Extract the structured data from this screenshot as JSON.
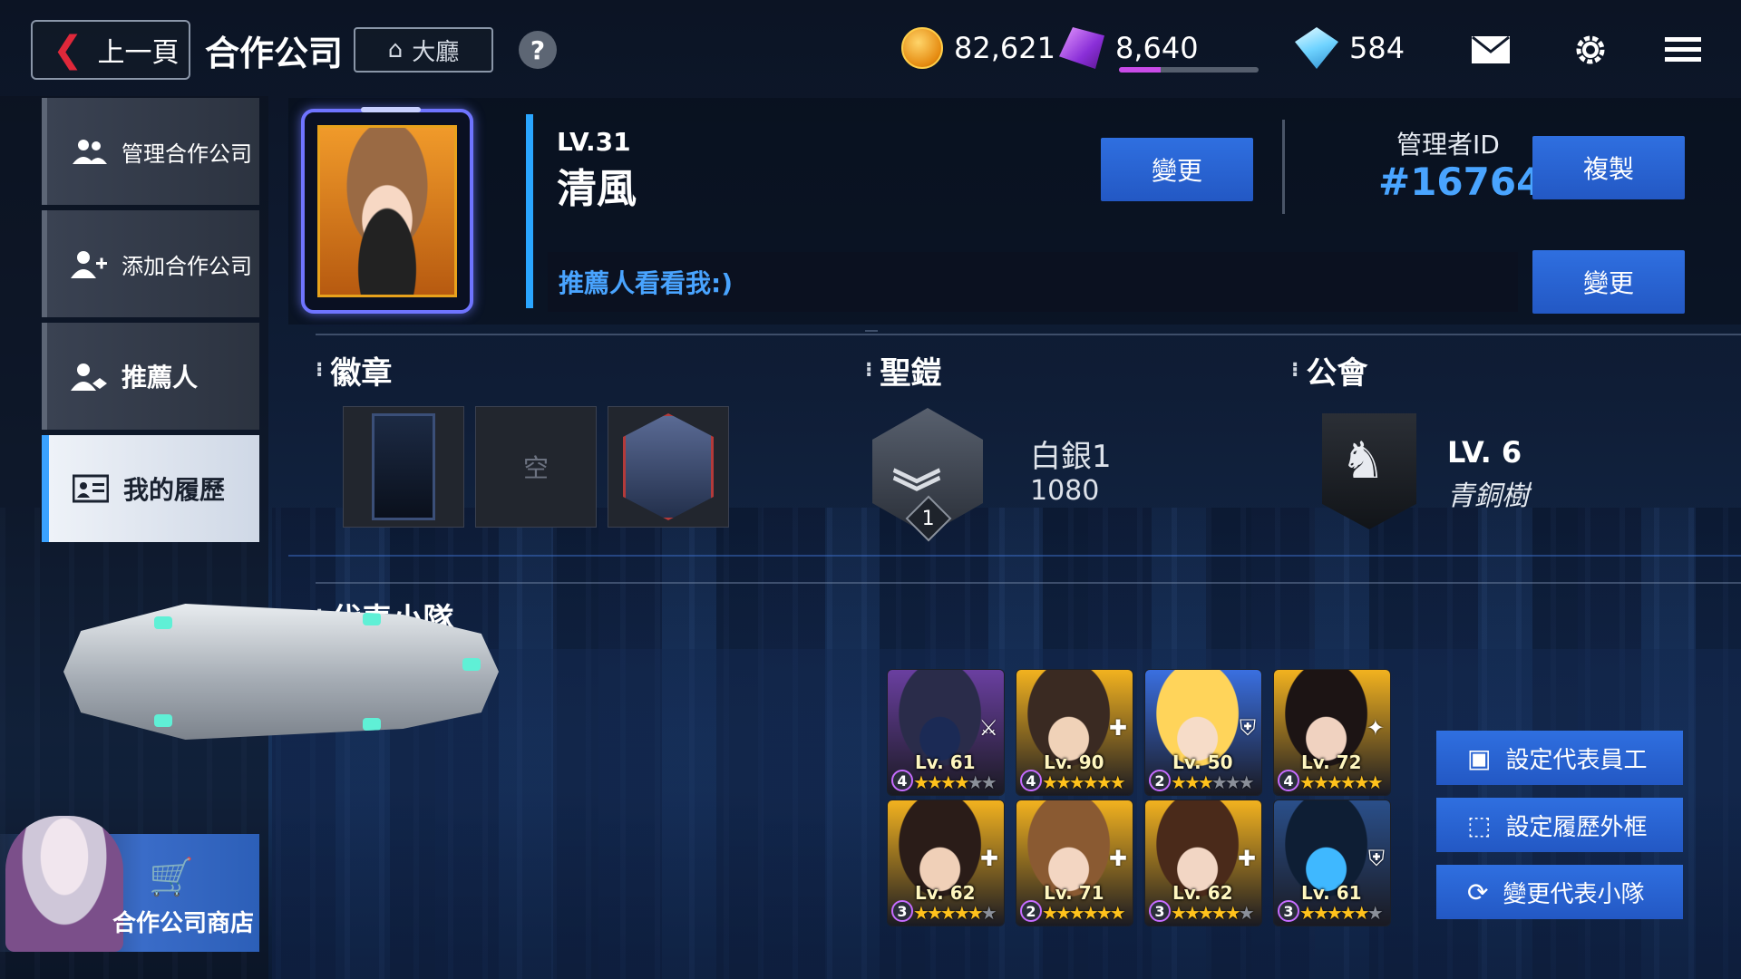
{
  "topbar": {
    "back_label": "上一頁",
    "title": "合作公司",
    "lobby_label": "大廳",
    "help_label": "?",
    "gold": "82,621",
    "gems": "8,640",
    "gem_progress": 0.3,
    "diamonds": "584"
  },
  "sidebar": {
    "items": [
      {
        "label": "管理合作公司",
        "icon": "group-icon"
      },
      {
        "label": "添加合作公司",
        "icon": "add-user-icon"
      },
      {
        "label": "推薦人",
        "icon": "handshake-icon"
      },
      {
        "label": "我的履歷",
        "icon": "profile-card-icon"
      }
    ],
    "active_index": 3,
    "shop_label": "合作公司商店"
  },
  "profile": {
    "level": "LV.31",
    "name": "清風",
    "change_name_label": "變更",
    "admin_id_label": "管理者ID",
    "admin_id": "#16764",
    "copy_label": "複製",
    "intro": "推薦人看看我:)",
    "change_intro_label": "變更"
  },
  "sections": {
    "badges_title": "徽章",
    "armor_title": "聖鎧",
    "guild_title": "公會",
    "team_title": "代表小隊"
  },
  "badges": {
    "empty_label": "空"
  },
  "armor": {
    "rank": "白銀1",
    "points": "1080",
    "tier_number": "1"
  },
  "guild": {
    "level": "LV. 6",
    "rank": "青銅樹"
  },
  "team": {
    "members": [
      {
        "level": "Lv. 61",
        "grade": "4",
        "stars": 4
      },
      {
        "level": "Lv. 90",
        "grade": "4",
        "stars": 6
      },
      {
        "level": "Lv. 50",
        "grade": "2",
        "stars": 3
      },
      {
        "level": "Lv. 72",
        "grade": "4",
        "stars": 6
      },
      {
        "level": "Lv. 62",
        "grade": "3",
        "stars": 5
      },
      {
        "level": "Lv. 71",
        "grade": "2",
        "stars": 6
      },
      {
        "level": "Lv. 62",
        "grade": "3",
        "stars": 5
      },
      {
        "level": "Lv. 61",
        "grade": "3",
        "stars": 5
      }
    ],
    "buttons": {
      "set_rep": "設定代表員工",
      "set_frame": "設定履歷外框",
      "change_team": "變更代表小隊"
    }
  },
  "colors": {
    "accent_blue": "#2f6fe0",
    "id_blue": "#49a4ff",
    "back_red": "#e0283a",
    "gold_star": "#ffc21c"
  }
}
